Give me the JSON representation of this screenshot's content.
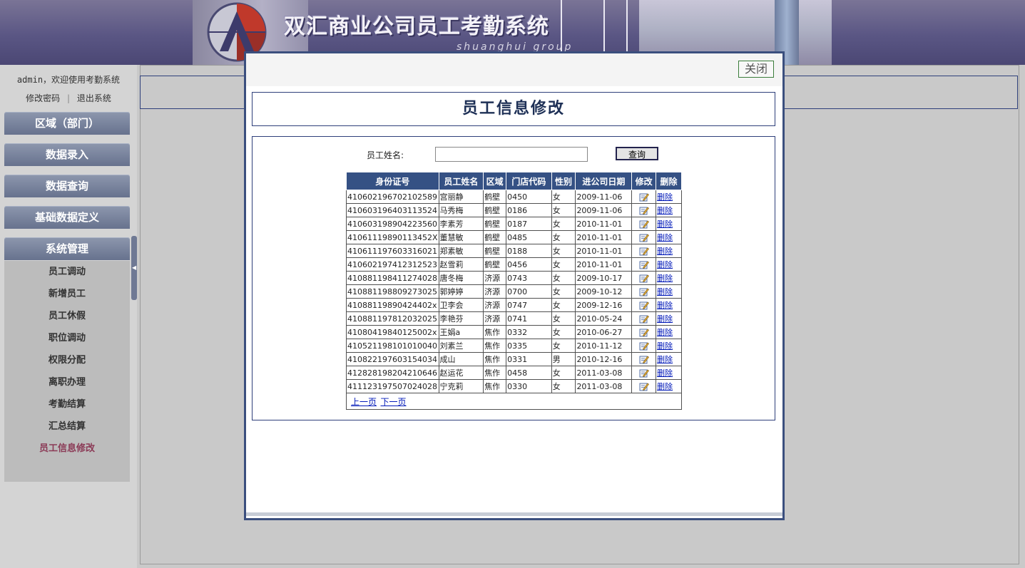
{
  "header": {
    "title": "双汇商业公司员工考勤系统",
    "subtitle": "shuanghui group"
  },
  "sidebar": {
    "user": "admin",
    "welcome": "，欢迎使用考勤系统",
    "change_password": "修改密码",
    "separator": "|",
    "logout": "退出系统",
    "menus": [
      {
        "label": "区域（部门）"
      },
      {
        "label": "数据录入"
      },
      {
        "label": "数据查询"
      },
      {
        "label": "基础数据定义"
      },
      {
        "label": "系统管理"
      }
    ],
    "submenu": [
      {
        "label": "员工调动"
      },
      {
        "label": "新增员工"
      },
      {
        "label": "员工休假"
      },
      {
        "label": "职位调动"
      },
      {
        "label": "权限分配"
      },
      {
        "label": "离职办理"
      },
      {
        "label": "考勤结算"
      },
      {
        "label": "汇总结算"
      },
      {
        "label": "员工信息修改"
      }
    ],
    "active_submenu": "员工信息修改"
  },
  "modal": {
    "close_label": "关闭",
    "title": "员工信息修改",
    "search": {
      "label": "员工姓名:",
      "value": "",
      "button": "查询"
    },
    "table": {
      "headers": [
        "身份证号",
        "员工姓名",
        "区域",
        "门店代码",
        "性别",
        "进公司日期",
        "修改",
        "删除"
      ],
      "delete_label": "删除",
      "rows": [
        [
          "410602196702102589",
          "宫丽静",
          "鹤壁",
          "0450",
          "女",
          "2009-11-06"
        ],
        [
          "410603196403113524",
          "马秀梅",
          "鹤壁",
          "0186",
          "女",
          "2009-11-06"
        ],
        [
          "410603198904223560",
          "李素芳",
          "鹤壁",
          "0187",
          "女",
          "2010-11-01"
        ],
        [
          "41061119890113452X",
          "董慧敏",
          "鹤壁",
          "0485",
          "女",
          "2010-11-01"
        ],
        [
          "410611197603316021",
          "郑素敏",
          "鹤壁",
          "0188",
          "女",
          "2010-11-01"
        ],
        [
          "410602197412312523",
          "赵雪莉",
          "鹤壁",
          "0456",
          "女",
          "2010-11-01"
        ],
        [
          "410881198411274028",
          "唐冬梅",
          "济源",
          "0743",
          "女",
          "2009-10-17"
        ],
        [
          "410881198809273025",
          "郭婷婷",
          "济源",
          "0700",
          "女",
          "2009-10-12"
        ],
        [
          "41088119890424402x",
          "卫李会",
          "济源",
          "0747",
          "女",
          "2009-12-16"
        ],
        [
          "410881197812032025",
          "李艳芬",
          "济源",
          "0741",
          "女",
          "2010-05-24"
        ],
        [
          "41080419840125002x",
          "王娟a",
          "焦作",
          "0332",
          "女",
          "2010-06-27"
        ],
        [
          "410521198101010040",
          "刘素兰",
          "焦作",
          "0335",
          "女",
          "2010-11-12"
        ],
        [
          "410822197603154034",
          "成山",
          "焦作",
          "0331",
          "男",
          "2010-12-16"
        ],
        [
          "412828198204210646",
          "赵运花",
          "焦作",
          "0458",
          "女",
          "2011-03-08"
        ],
        [
          "411123197507024028",
          "宁克莉",
          "焦作",
          "0330",
          "女",
          "2011-03-08"
        ]
      ]
    },
    "pager": {
      "prev": "上一页",
      "next": "下一页"
    }
  },
  "colors": {
    "header_bg": "#5a5684",
    "table_header": "#355184",
    "modal_border": "#3b4f7e",
    "active_menu": "#8b3a56",
    "link": "#0018b8"
  }
}
